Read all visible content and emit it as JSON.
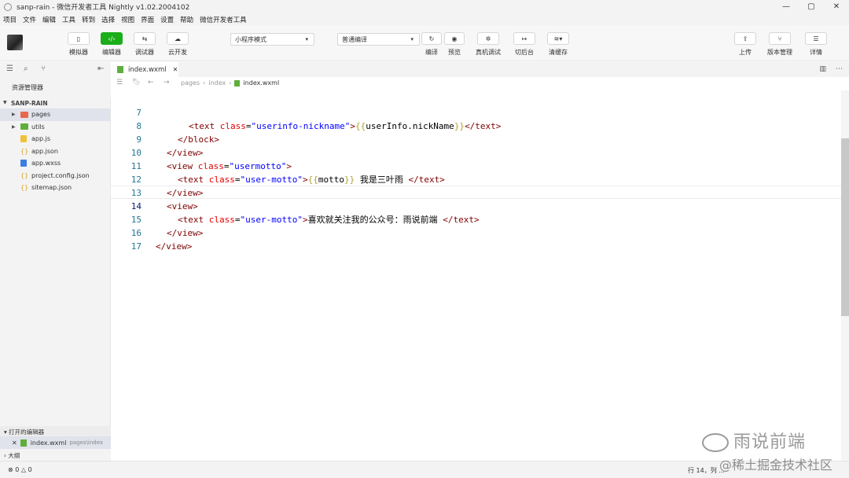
{
  "window": {
    "title": "sanp-rain - 微信开发者工具 Nightly v1.02.2004102",
    "controls": [
      "—",
      "▢",
      "✕"
    ]
  },
  "menu": [
    "项目",
    "文件",
    "编辑",
    "工具",
    "转到",
    "选择",
    "视图",
    "界面",
    "设置",
    "帮助",
    "微信开发者工具"
  ],
  "toolbar": {
    "simulator": "模拟器",
    "editor": "编辑器",
    "debugger": "调试器",
    "cloud": "云开发",
    "mode_select": "小程序模式",
    "compile_select": "普通编译",
    "compile": "编译",
    "preview": "预览",
    "real_debug": "真机调试",
    "background": "切后台",
    "clear_cache": "清缓存",
    "upload": "上传",
    "version": "版本管理",
    "details": "详情"
  },
  "sidebar": {
    "title": "资源管理器",
    "project": "SANP-RAIN",
    "items": [
      {
        "name": "pages",
        "type": "folder"
      },
      {
        "name": "utils",
        "type": "folder"
      },
      {
        "name": "app.js",
        "type": "js"
      },
      {
        "name": "app.json",
        "type": "json"
      },
      {
        "name": "app.wxss",
        "type": "wxss"
      },
      {
        "name": "project.config.json",
        "type": "json"
      },
      {
        "name": "sitemap.json",
        "type": "json"
      }
    ],
    "open_editors": "打开的编辑器",
    "open_file": "index.wxml",
    "open_file_path": "pages\\index",
    "outline": "大纲"
  },
  "editor": {
    "tab": "index.wxml",
    "breadcrumb": [
      "pages",
      "index",
      "index.wxml"
    ],
    "lines": {
      "l7": {
        "num": "7",
        "s1": "<text ",
        "a1": "class",
        "s2": "=",
        "v1": "\"userinfo-nickname\"",
        "s3": ">",
        "m1": "{{",
        "t1": "userInfo.nickName",
        "m2": "}}",
        "s4": "</text>"
      },
      "l8": {
        "num": "8",
        "s1": "</block>"
      },
      "l9": {
        "num": "9",
        "s1": "</view>"
      },
      "l10": {
        "num": "10",
        "s1": "<view ",
        "a1": "class",
        "s2": "=",
        "v1": "\"usermotto\"",
        "s3": ">"
      },
      "l11": {
        "num": "11",
        "s1": "<text ",
        "a1": "class",
        "s2": "=",
        "v1": "\"user-motto\"",
        "s3": ">",
        "m1": "{{",
        "t1": "motto",
        "m2": "}}",
        "t2": " 我是三叶雨 ",
        "s4": "</text>"
      },
      "l12": {
        "num": "12",
        "s1": "</view>"
      },
      "l13": {
        "num": "13",
        "s1": "<view>"
      },
      "l14": {
        "num": "14",
        "s1": "<text ",
        "a1": "class",
        "s2": "=",
        "v1": "\"user-motto\"",
        "s3": ">",
        "t1": "喜欢就关注我的公众号：雨说前端 ",
        "s4": "</text>"
      },
      "l15": {
        "num": "15",
        "s1": "</view>"
      },
      "l16": {
        "num": "16",
        "s1": "</view>"
      },
      "l17": {
        "num": "17"
      }
    }
  },
  "status": {
    "problems": "⊗ 0 △ 0",
    "position": "行 14，列 ..."
  },
  "watermarks": {
    "brand": "雨说前端",
    "community": "@稀土掘金技术社区"
  }
}
